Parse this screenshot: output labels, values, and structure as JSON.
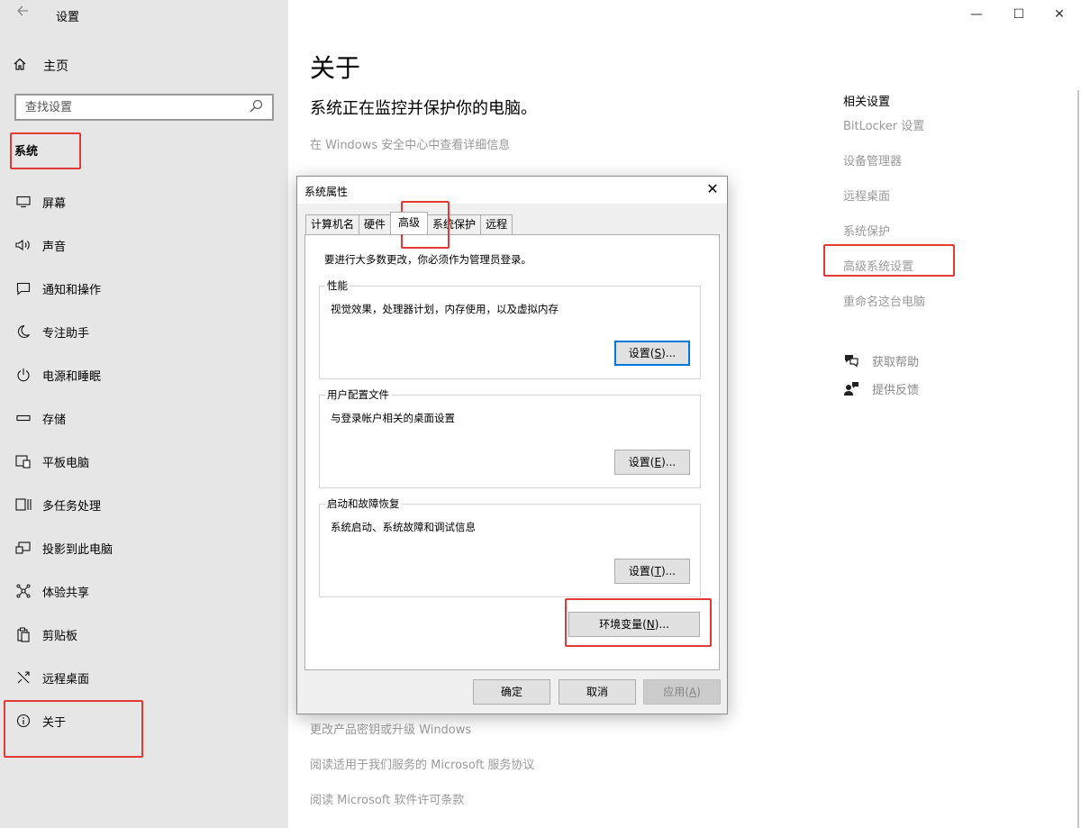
{
  "window": {
    "title": "设置",
    "minimize": "—",
    "maximize": "☐",
    "close": "✕"
  },
  "sidebar": {
    "home_label": "主页",
    "search_placeholder": "查找设置",
    "section": "系统",
    "items": [
      {
        "label": "屏幕",
        "icon": "monitor-icon"
      },
      {
        "label": "声音",
        "icon": "speaker-icon"
      },
      {
        "label": "通知和操作",
        "icon": "notification-icon"
      },
      {
        "label": "专注助手",
        "icon": "moon-icon"
      },
      {
        "label": "电源和睡眠",
        "icon": "power-icon"
      },
      {
        "label": "存储",
        "icon": "storage-icon"
      },
      {
        "label": "平板电脑",
        "icon": "tablet-icon"
      },
      {
        "label": "多任务处理",
        "icon": "multitask-icon"
      },
      {
        "label": "投影到此电脑",
        "icon": "project-icon"
      },
      {
        "label": "体验共享",
        "icon": "share-icon"
      },
      {
        "label": "剪贴板",
        "icon": "clipboard-icon"
      },
      {
        "label": "远程桌面",
        "icon": "remote-icon"
      },
      {
        "label": "关于",
        "icon": "info-icon"
      }
    ]
  },
  "main": {
    "title": "关于",
    "subtitle": "系统正在监控并保护你的电脑。",
    "security_link": "在 Windows 安全中心中查看详细信息",
    "bottom_links": [
      "更改产品密钥或升级 Windows",
      "阅读适用于我们服务的 Microsoft 服务协议",
      "阅读 Microsoft 软件许可条款"
    ]
  },
  "related": {
    "header": "相关设置",
    "links": [
      "BitLocker 设置",
      "设备管理器",
      "远程桌面",
      "系统保护",
      "高级系统设置",
      "重命名这台电脑"
    ],
    "help": "获取帮助",
    "feedback": "提供反馈"
  },
  "dialog": {
    "title": "系统属性",
    "close": "✕",
    "tabs": [
      "计算机名",
      "硬件",
      "高级",
      "系统保护",
      "远程"
    ],
    "note": "要进行大多数更改，你必须作为管理员登录。",
    "performance": {
      "label": "性能",
      "desc": "视觉效果，处理器计划，内存使用，以及虚拟内存",
      "btn_pre": "设置(",
      "btn_key": "S",
      "btn_post": ")..."
    },
    "profiles": {
      "label": "用户配置文件",
      "desc": "与登录帐户相关的桌面设置",
      "btn_pre": "设置(",
      "btn_key": "E",
      "btn_post": ")..."
    },
    "startup": {
      "label": "启动和故障恢复",
      "desc": "系统启动、系统故障和调试信息",
      "btn_pre": "设置(",
      "btn_key": "T",
      "btn_post": ")..."
    },
    "env": {
      "pre": "环境变量(",
      "key": "N",
      "post": ")..."
    },
    "ok": "确定",
    "cancel": "取消",
    "apply_pre": "应用(",
    "apply_key": "A",
    "apply_post": ")"
  },
  "colors": {
    "highlight": "#e53935",
    "accent": "#0078d7",
    "sidebar_bg": "#e6e6e6"
  }
}
